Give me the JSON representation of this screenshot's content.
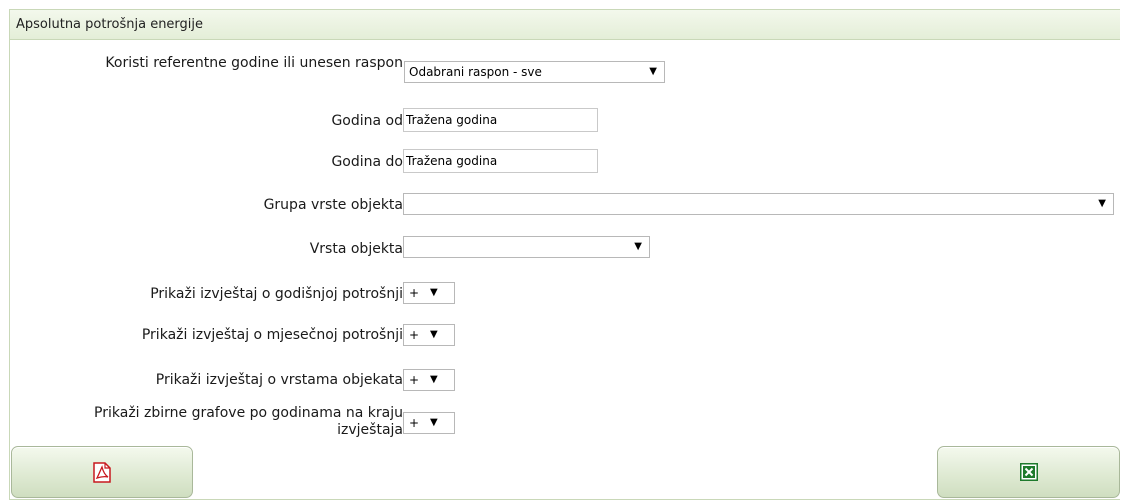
{
  "panel": {
    "title": "Apsolutna potrošnja energije"
  },
  "form": {
    "range_mode": {
      "label": "Koristi referentne godine ili unesen raspon",
      "value": "Odabrani raspon - sve"
    },
    "year_from": {
      "label": "Godina od",
      "value": "Tražena godina"
    },
    "year_to": {
      "label": "Godina do",
      "value": "Tražena godina"
    },
    "object_group": {
      "label": "Grupa vrste objekta",
      "value": ""
    },
    "object_type": {
      "label": "Vrsta objekta",
      "value": ""
    },
    "yearly_report": {
      "label": "Prikaži izvještaj o godišnjoj potrošnji",
      "value": "+"
    },
    "monthly_report": {
      "label": "Prikaži izvještaj o mjesečnoj potrošnji",
      "value": "+"
    },
    "types_report": {
      "label": "Prikaži izvještaj o vrstama objekata",
      "value": "+"
    },
    "summary_charts": {
      "label": "Prikaži zbirne grafove po godinama na kraju izvještaja",
      "value": "+"
    }
  },
  "icons": {
    "dropdown": "▼",
    "pdf": "pdf-icon",
    "excel": "excel-icon"
  },
  "colors": {
    "header_bg": "#e4eed8",
    "border": "#c9d8b8",
    "pdf_red": "#c8181e",
    "excel_green": "#1e7a2c"
  }
}
